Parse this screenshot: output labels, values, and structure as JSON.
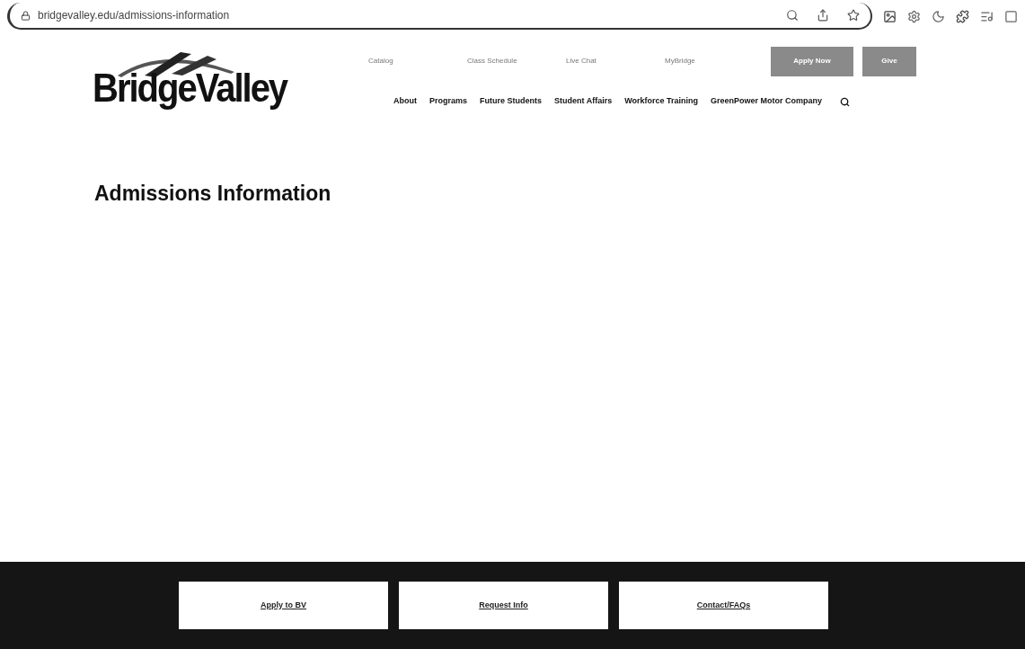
{
  "browser": {
    "url": "bridgevalley.edu/admissions-information"
  },
  "header": {
    "logo": "BridgeValley",
    "utility_links": [
      "Catalog",
      "Class Schedule",
      "Live Chat",
      "MyBridge"
    ],
    "utility_buttons": [
      "Apply Now",
      "Give"
    ],
    "nav": [
      "About",
      "Programs",
      "Future Students",
      "Student Affairs",
      "Workforce Training",
      "GreenPower Motor Company"
    ]
  },
  "page": {
    "title": "Admissions Information"
  },
  "footer": {
    "buttons": [
      "Apply to BV",
      "Request Info",
      "Contact/FAQs"
    ]
  }
}
